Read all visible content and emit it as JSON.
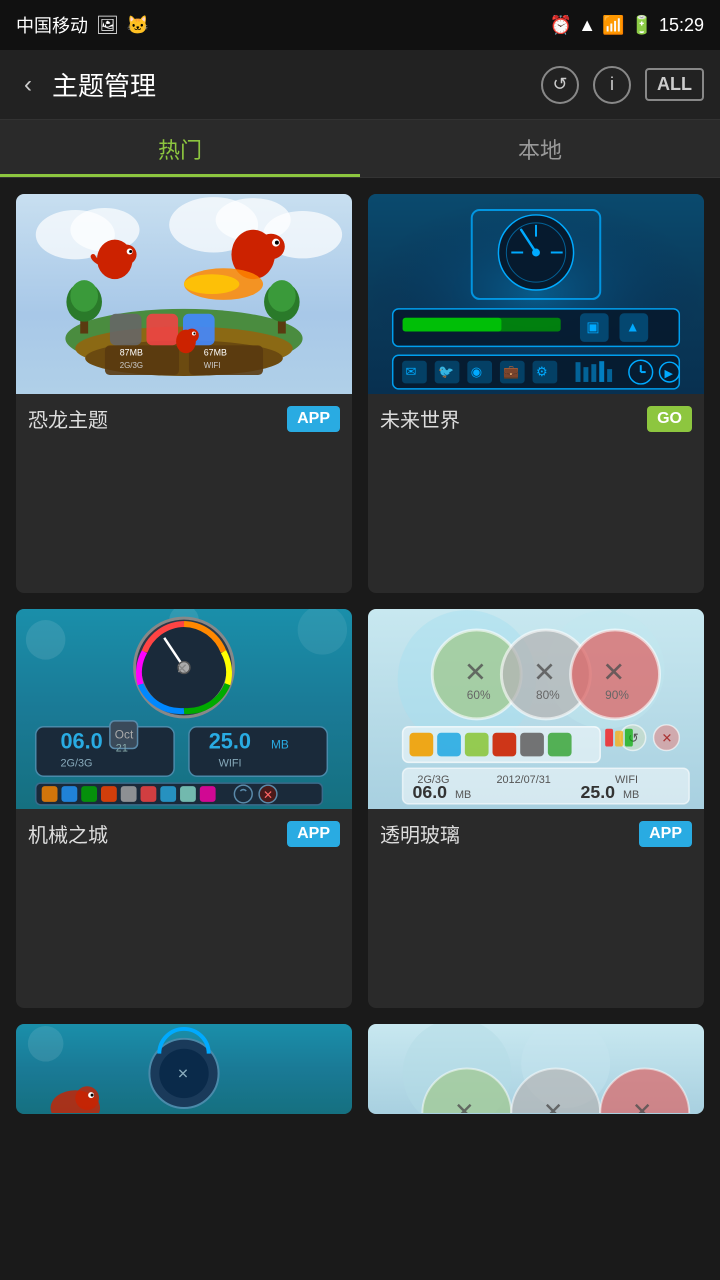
{
  "statusBar": {
    "carrier": "中国移动",
    "time": "15:29",
    "icons": [
      "photo",
      "cat",
      "alarm",
      "wifi",
      "signal",
      "battery"
    ]
  },
  "header": {
    "backLabel": "‹",
    "title": "主题管理",
    "refreshIcon": "↺",
    "infoIcon": "ⓘ",
    "allLabel": "ALL"
  },
  "tabs": [
    {
      "id": "hot",
      "label": "热门",
      "active": true
    },
    {
      "id": "local",
      "label": "本地",
      "active": false
    }
  ],
  "themes": [
    {
      "id": "dinosaur",
      "name": "恐龙主题",
      "badge": "APP",
      "badgeType": "app",
      "imageType": "dinosaur"
    },
    {
      "id": "future",
      "name": "未来世界",
      "badge": "GO",
      "badgeType": "go",
      "imageType": "future"
    },
    {
      "id": "mechanical",
      "name": "机械之城",
      "badge": "APP",
      "badgeType": "app",
      "imageType": "mechanical"
    },
    {
      "id": "glass",
      "name": "透明玻璃",
      "badge": "APP",
      "badgeType": "app",
      "imageType": "glass"
    }
  ],
  "bottomPartial": [
    {
      "id": "bottom1",
      "imageType": "mechanical-partial"
    },
    {
      "id": "bottom2",
      "imageType": "glass-partial"
    }
  ]
}
